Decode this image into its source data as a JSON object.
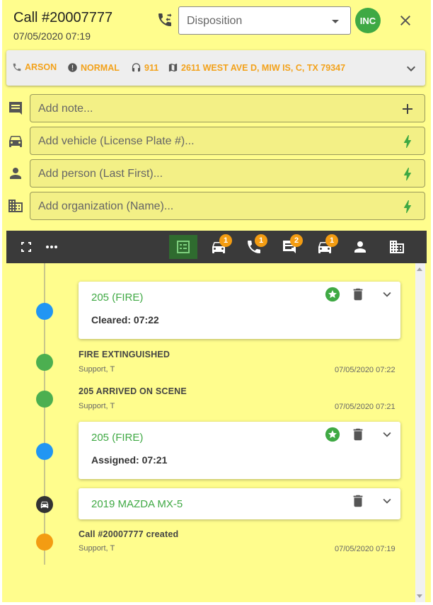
{
  "header": {
    "call_title": "Call #20007777",
    "call_date": "07/05/2020 07:19",
    "disposition_placeholder": "Disposition",
    "inc_label": "INC"
  },
  "infobar": {
    "type": "ARSON",
    "priority": "NORMAL",
    "source": "911",
    "address": "2611 WEST AVE D, MIW IS, C, TX 79347"
  },
  "add_rows": {
    "note": "Add note...",
    "vehicle": "Add vehicle (License Plate #)...",
    "person": "Add person (Last First)...",
    "organization": "Add organization (Name)..."
  },
  "toolbar": {
    "counts": {
      "vehicles": "1",
      "calls": "1",
      "messages": "2",
      "units": "1"
    }
  },
  "timeline": {
    "card1": {
      "title": "205 (FIRE)",
      "subtitle": "Cleared: 07:22"
    },
    "entry1": {
      "title": "FIRE EXTINGUISHED",
      "user": "Support, T",
      "time": "07/05/2020 07:22"
    },
    "entry2": {
      "title": "205 ARRIVED ON SCENE",
      "user": "Support, T",
      "time": "07/05/2020 07:21"
    },
    "card2": {
      "title": "205 (FIRE)",
      "subtitle": "Assigned: 07:21"
    },
    "card3": {
      "title": "2019 MAZDA MX-5"
    },
    "entry3": {
      "title": "Call #20007777 created",
      "user": "Support, T",
      "time": "07/05/2020 07:19"
    }
  },
  "colors": {
    "panel_bg": "#fffd8d",
    "accent_green": "#3fa944",
    "accent_orange": "#f3a21b",
    "dot_blue": "#2196f3",
    "dot_green": "#4caf50",
    "dot_orange": "#f39c12",
    "toolbar_bg": "#3a3a3a"
  }
}
